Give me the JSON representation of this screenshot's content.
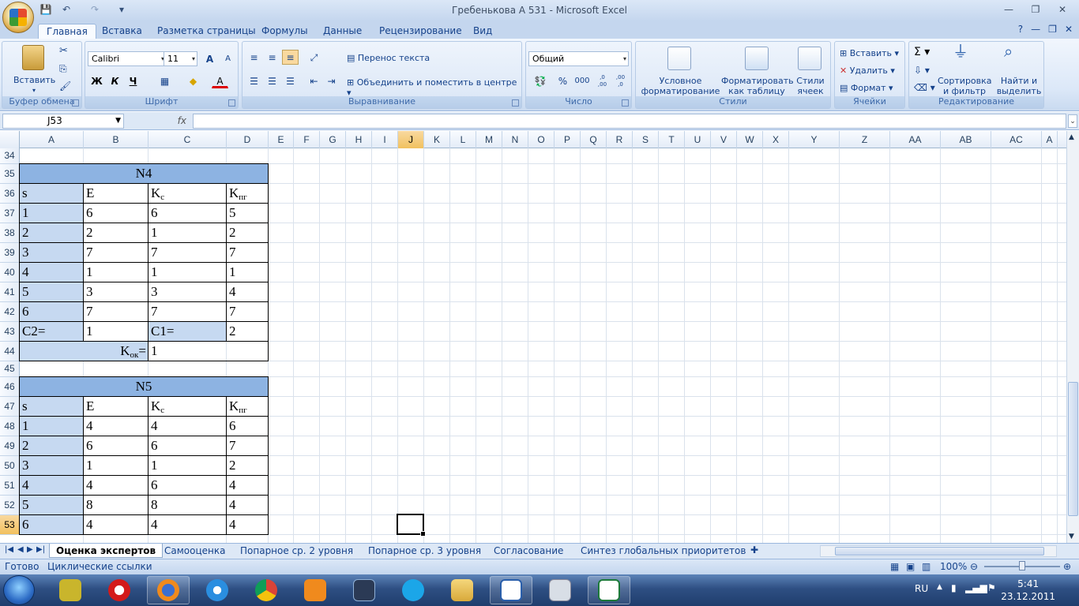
{
  "window": {
    "title": "Гребенькова А 531 - Microsoft Excel"
  },
  "qat": {
    "save": "💾",
    "undo": "↶",
    "redo": "↷",
    "more": "▾"
  },
  "tabs": [
    "Главная",
    "Вставка",
    "Разметка страницы",
    "Формулы",
    "Данные",
    "Рецензирование",
    "Вид"
  ],
  "ribbon": {
    "clipboard": {
      "label": "Буфер обмена",
      "paste": "Вставить"
    },
    "font": {
      "label": "Шрифт",
      "name": "Calibri",
      "size": "11",
      "bold": "Ж",
      "italic": "К",
      "underline": "Ч",
      "grow": "A",
      "shrink": "A",
      "fontcolor": "A"
    },
    "align": {
      "label": "Выравнивание",
      "wrap": "Перенос текста",
      "merge": "Объединить и поместить в центре"
    },
    "number": {
      "label": "Число",
      "format": "Общий",
      "percent": "%",
      "thousands": "000",
      "inc_dec": ",0 ,00",
      "dec_dec": ",00 ,0"
    },
    "styles": {
      "label": "Стили",
      "cond": "Условное форматирование",
      "table": "Форматировать как таблицу",
      "cell": "Стили ячеек"
    },
    "cells": {
      "label": "Ячейки",
      "insert": "Вставить",
      "delete": "Удалить",
      "format": "Формат"
    },
    "edit": {
      "label": "Редактирование",
      "sum": "Σ",
      "sort": "Сортировка и фильтр",
      "find": "Найти и выделить"
    }
  },
  "formula": {
    "namebox": "J53",
    "fx": "fx",
    "content": ""
  },
  "columns": [
    "A",
    "B",
    "C",
    "D",
    "E",
    "F",
    "G",
    "H",
    "I",
    "J",
    "K",
    "L",
    "M",
    "N",
    "O",
    "P",
    "Q",
    "R",
    "S",
    "T",
    "U",
    "V",
    "W",
    "X",
    "Y",
    "Z",
    "AA",
    "AB",
    "AC",
    "A"
  ],
  "rows": [
    "34",
    "35",
    "36",
    "37",
    "38",
    "39",
    "40",
    "41",
    "42",
    "43",
    "44",
    "45",
    "46",
    "47",
    "48",
    "49",
    "50",
    "51",
    "52",
    "53"
  ],
  "table1": {
    "title": "N4",
    "head": {
      "s": "s",
      "e": "E",
      "kc": "K",
      "kc_sub": "c",
      "kpg": "K",
      "kpg_sub": "пг"
    },
    "data": [
      [
        "1",
        "6",
        "6",
        "5"
      ],
      [
        "2",
        "2",
        "1",
        "2"
      ],
      [
        "3",
        "7",
        "7",
        "7"
      ],
      [
        "4",
        "1",
        "1",
        "1"
      ],
      [
        "5",
        "3",
        "3",
        "4"
      ],
      [
        "6",
        "7",
        "7",
        "7"
      ]
    ],
    "c2_label": "C2=",
    "c2": "1",
    "c1_label": "C1=",
    "c1": "2",
    "kok_label": "K",
    "kok_sub": "ок",
    "kok_eq": "=",
    "kok": "1"
  },
  "table2": {
    "title": "N5",
    "head": {
      "s": "s",
      "e": "E",
      "kc": "K",
      "kc_sub": "c",
      "kpg": "K",
      "kpg_sub": "пг"
    },
    "data": [
      [
        "1",
        "4",
        "4",
        "6"
      ],
      [
        "2",
        "6",
        "6",
        "7"
      ],
      [
        "3",
        "1",
        "1",
        "2"
      ],
      [
        "4",
        "4",
        "6",
        "4"
      ],
      [
        "5",
        "8",
        "8",
        "4"
      ],
      [
        "6",
        "4",
        "4",
        "4"
      ]
    ]
  },
  "sheets": [
    "Оценка экспертов",
    "Самооценка",
    "Попарное ср. 2 уровня",
    "Попарное ср. 3 уровня",
    "Согласование",
    "Синтез глобальных приоритетов"
  ],
  "status": {
    "ready": "Готово",
    "circ": "Циклические ссылки",
    "zoom": "100%"
  },
  "tray": {
    "lang": "RU",
    "time": "5:41",
    "date": "23.12.2011"
  }
}
